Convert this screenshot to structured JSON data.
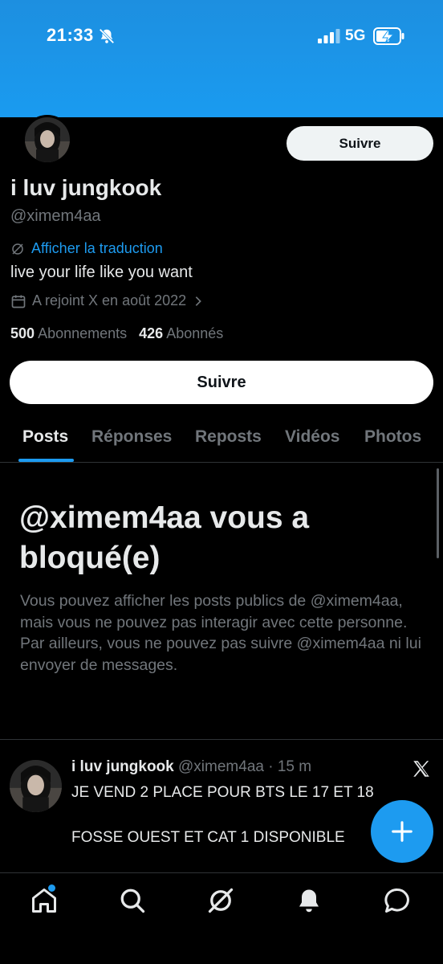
{
  "status_bar": {
    "time": "21:33",
    "network": "5G",
    "bg_color": "#1a9bf0"
  },
  "profile": {
    "display_name": "i luv jungkook",
    "handle": "@ximem4aa",
    "translate_label": "Afficher la traduction",
    "bio": "live your life like you want",
    "joined": "A rejoint X en août 2022",
    "following_count": "500",
    "following_label": "Abonnements",
    "followers_count": "426",
    "followers_label": "Abonnés",
    "follow_label": "Suivre",
    "follow_wide_label": "Suivre"
  },
  "tabs": [
    {
      "label": "Posts",
      "active": true
    },
    {
      "label": "Réponses",
      "active": false
    },
    {
      "label": "Reposts",
      "active": false
    },
    {
      "label": "Vidéos",
      "active": false
    },
    {
      "label": "Photos",
      "active": false
    }
  ],
  "blocked": {
    "title": "@ximem4aa vous a bloqué(e)",
    "description": "Vous pouvez afficher les posts publics de @ximem4aa, mais vous ne pouvez pas interagir avec cette personne. Par ailleurs, vous ne pouvez pas suivre @ximem4aa ni lui envoyer de messages."
  },
  "post": {
    "name": "i luv jungkook",
    "handle": "@ximem4aa",
    "separator": "·",
    "time": "15 m",
    "line1": "JE VEND 2 PLACE POUR BTS LE 17 ET 18",
    "line2": "FOSSE OUEST ET CAT 1 DISPONIBLE"
  },
  "bottom_nav": [
    {
      "icon": "home-icon",
      "has_dot": true
    },
    {
      "icon": "search-icon"
    },
    {
      "icon": "grok-icon"
    },
    {
      "icon": "notifications-bell-icon"
    },
    {
      "icon": "messages-icon"
    }
  ],
  "colors": {
    "accent": "#1d9bf0",
    "background": "#000000",
    "muted_text": "#71767b",
    "primary_text": "#e7e9ea"
  }
}
